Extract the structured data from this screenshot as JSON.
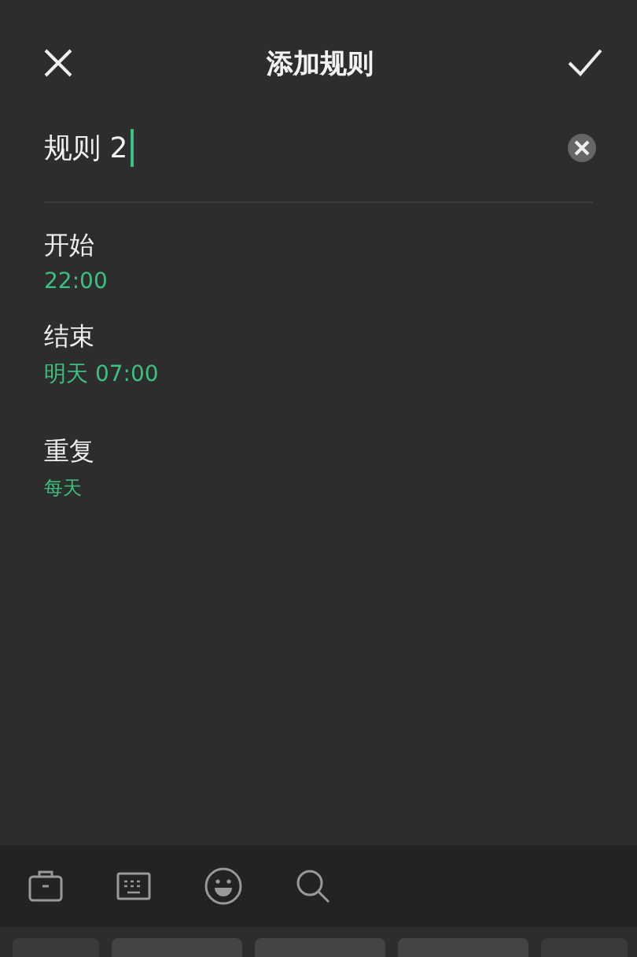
{
  "header": {
    "title": "添加规则"
  },
  "name_field": {
    "value": "规则 2"
  },
  "settings": [
    {
      "label": "开始",
      "value": "22:00"
    },
    {
      "label": "结束",
      "value": "明天 07:00"
    },
    {
      "label": "重复",
      "value": "每天",
      "kind": "small"
    }
  ],
  "keyboard_toolbar": [
    {
      "kind": "clipboard"
    },
    {
      "kind": "keyboard"
    },
    {
      "kind": "emoji"
    },
    {
      "kind": "search"
    }
  ],
  "keyboard_keys": [
    {
      "kind": "key"
    },
    {
      "kind": "key"
    },
    {
      "kind": "key"
    },
    {
      "kind": "key"
    },
    {
      "kind": "key"
    }
  ]
}
